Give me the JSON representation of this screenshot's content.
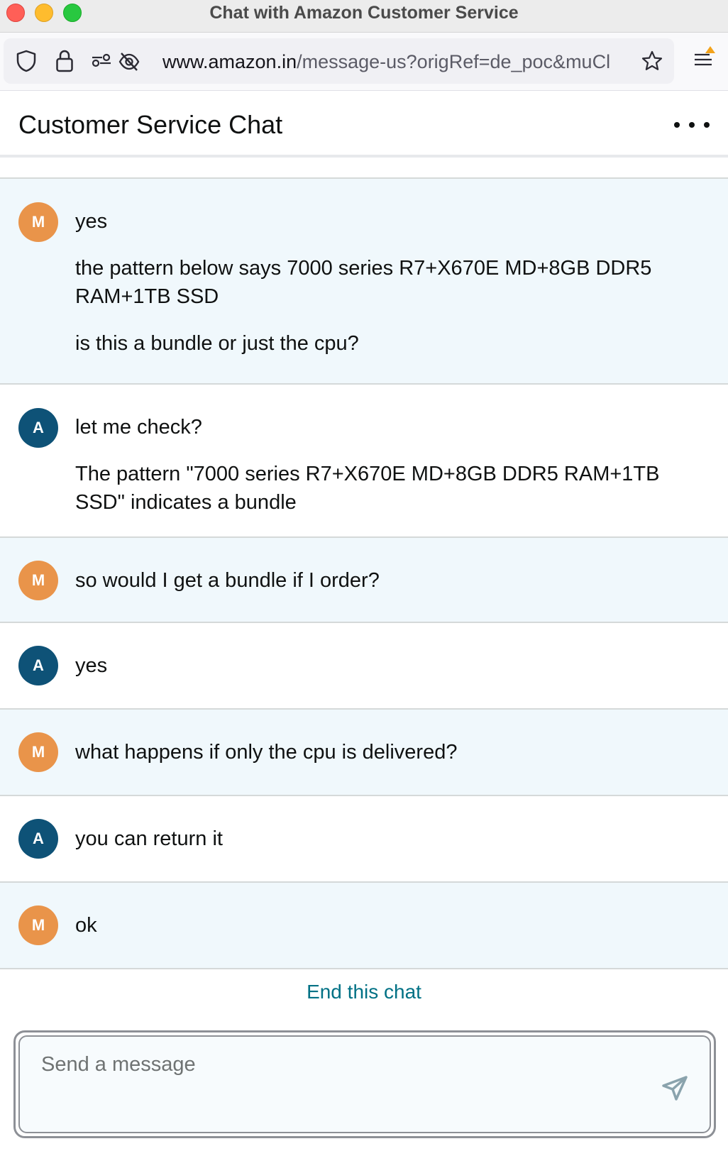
{
  "window": {
    "title": "Chat with Amazon Customer Service"
  },
  "toolbar": {
    "url_host": "www.amazon.in",
    "url_path": "/message-us?origRef=de_poc&muCl"
  },
  "chat": {
    "title": "Customer Service Chat",
    "messages": [
      {
        "sender": "customer",
        "initial": "M",
        "lines": [
          "yes",
          "the pattern below says 7000 series R7+X670E MD+8GB DDR5 RAM+1TB SSD",
          "is this a bundle or just the cpu?"
        ]
      },
      {
        "sender": "agent",
        "initial": "A",
        "lines": [
          "let me check?",
          "The pattern \"7000 series R7+X670E MD+8GB DDR5 RAM+1TB SSD\" indicates a bundle"
        ]
      },
      {
        "sender": "customer",
        "initial": "M",
        "lines": [
          "so would I get a bundle if I order?"
        ]
      },
      {
        "sender": "agent",
        "initial": "A",
        "lines": [
          "yes"
        ]
      },
      {
        "sender": "customer",
        "initial": "M",
        "lines": [
          "what happens if only the cpu is delivered?"
        ]
      },
      {
        "sender": "agent",
        "initial": "A",
        "lines": [
          "you can return it"
        ]
      },
      {
        "sender": "customer",
        "initial": "M",
        "lines": [
          "ok"
        ]
      }
    ],
    "end_chat_label": "End this chat",
    "composer_placeholder": "Send a message"
  },
  "colors": {
    "customer_avatar": "#e9944a",
    "agent_avatar": "#0e5277",
    "customer_row_bg": "#f0f8fc",
    "link": "#007185"
  },
  "icons": {
    "url_bar": [
      "shield-icon",
      "lock-icon",
      "permissions-icon",
      "tracking-blocked-icon",
      "bookmark-star-icon"
    ],
    "menu": "app-menu-icon",
    "send": "send-icon",
    "more": "more-options-icon"
  }
}
